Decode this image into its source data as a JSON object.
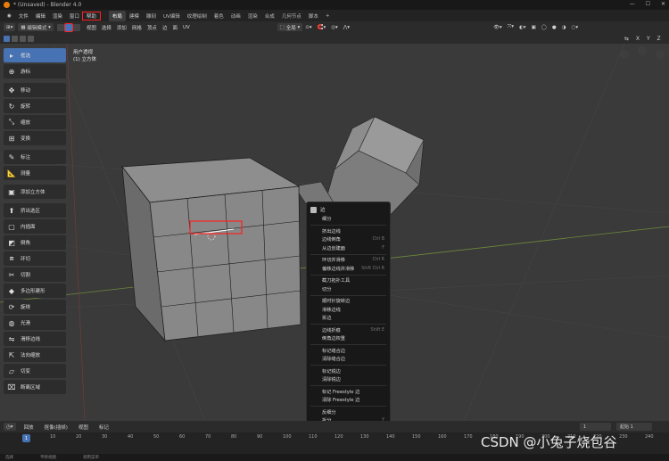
{
  "title": "* (Unsaved) - Blender 4.0",
  "menus": [
    "文件",
    "编辑",
    "渲染",
    "窗口",
    "帮助"
  ],
  "workspaces": [
    "布局",
    "建模",
    "雕刻",
    "UV编辑",
    "纹理绘制",
    "着色",
    "动画",
    "渲染",
    "合成",
    "几何节点",
    "脚本"
  ],
  "active_workspace_index": 0,
  "header": {
    "mode": "编辑模式",
    "menus": [
      "视图",
      "选择",
      "添加",
      "网格",
      "顶点",
      "边",
      "面",
      "UV"
    ],
    "transform": "全局"
  },
  "overlay": {
    "view_name": "用户透视",
    "object": "(1) 立方体"
  },
  "tools": [
    {
      "icon": "select-box-icon",
      "label": "框选",
      "active": true,
      "glyph": "▸"
    },
    {
      "icon": "cursor-icon",
      "label": "游标",
      "glyph": "⊕"
    },
    {
      "icon": "move-icon",
      "label": "移动",
      "glyph": "✥",
      "gap": true
    },
    {
      "icon": "rotate-icon",
      "label": "旋转",
      "glyph": "↻"
    },
    {
      "icon": "scale-icon",
      "label": "缩放",
      "glyph": "⤡"
    },
    {
      "icon": "transform-icon",
      "label": "变换",
      "glyph": "⊞"
    },
    {
      "icon": "annotate-icon",
      "label": "标注",
      "glyph": "✎",
      "gap": true
    },
    {
      "icon": "measure-icon",
      "label": "测量",
      "glyph": "📐"
    },
    {
      "icon": "add-cube-icon",
      "label": "添加立方体",
      "glyph": "▣",
      "gap": true
    },
    {
      "icon": "extrude-icon",
      "label": "挤出选区",
      "glyph": "⬆",
      "gap": true
    },
    {
      "icon": "inset-icon",
      "label": "内插面",
      "glyph": "▢"
    },
    {
      "icon": "bevel-icon",
      "label": "倒角",
      "glyph": "◩"
    },
    {
      "icon": "loop-cut-icon",
      "label": "环切",
      "glyph": "⧈"
    },
    {
      "icon": "knife-icon",
      "label": "切割",
      "glyph": "✂"
    },
    {
      "icon": "poly-build-icon",
      "label": "多边形建形",
      "glyph": "◆"
    },
    {
      "icon": "spin-icon",
      "label": "旋绕",
      "glyph": "⟳"
    },
    {
      "icon": "smooth-icon",
      "label": "光滑",
      "glyph": "◍"
    },
    {
      "icon": "edge-slide-icon",
      "label": "滑移边线",
      "glyph": "⇋"
    },
    {
      "icon": "shrink-fatten-icon",
      "label": "法向缩放",
      "glyph": "⇱"
    },
    {
      "icon": "shear-icon",
      "label": "切变",
      "glyph": "▱"
    },
    {
      "icon": "rip-region-icon",
      "label": "断离区域",
      "glyph": "⌧"
    }
  ],
  "context_menu": {
    "title": "边",
    "groups": [
      [
        {
          "label": "细分",
          "shortcut": ""
        }
      ],
      [
        {
          "label": "挤出边线",
          "shortcut": ""
        },
        {
          "label": "边线倒角",
          "shortcut": "Ctrl B"
        },
        {
          "label": "从边创建面",
          "shortcut": "F"
        }
      ],
      [
        {
          "label": "环切并滑移",
          "shortcut": "Ctrl R"
        },
        {
          "label": "偏移边线并滑移",
          "shortcut": "Shift Ctrl R"
        }
      ],
      [
        {
          "label": "截刀拓扑工具",
          "shortcut": ""
        },
        {
          "label": "切分",
          "shortcut": ""
        }
      ],
      [
        {
          "label": "顺时针旋转边",
          "shortcut": ""
        },
        {
          "label": "滑移边线",
          "shortcut": ""
        },
        {
          "label": "拆边",
          "shortcut": ""
        }
      ],
      [
        {
          "label": "边线折痕",
          "shortcut": "Shift E"
        },
        {
          "label": "倒角边权重",
          "shortcut": ""
        }
      ],
      [
        {
          "label": "标记缝合边",
          "shortcut": ""
        },
        {
          "label": "清除缝合边",
          "shortcut": ""
        }
      ],
      [
        {
          "label": "标记锐边",
          "shortcut": ""
        },
        {
          "label": "清除锐边",
          "shortcut": ""
        }
      ],
      [
        {
          "label": "标记 Freestyle 边",
          "shortcut": ""
        },
        {
          "label": "清除 Freestyle 边",
          "shortcut": ""
        }
      ],
      [
        {
          "label": "反细分",
          "shortcut": ""
        },
        {
          "label": "拆分",
          "shortcut": "Y"
        },
        {
          "label": "分离",
          "shortcut": "P"
        },
        {
          "label": "断开边",
          "shortcut": "",
          "highlight": true
        },
        {
          "label": "断开边",
          "shortcut": ""
        }
      ]
    ]
  },
  "timeline": {
    "menus": [
      "回放",
      "抠像(插帧)",
      "视图",
      "标记"
    ],
    "current_frame": "1",
    "start": "1",
    "end_label": "起始",
    "ticks": [
      "1",
      "10",
      "20",
      "30",
      "40",
      "50",
      "60",
      "70",
      "80",
      "90",
      "100",
      "110",
      "120",
      "130",
      "140",
      "150",
      "160",
      "170",
      "180",
      "190",
      "200",
      "210",
      "220",
      "230",
      "240",
      "250"
    ]
  },
  "status": [
    "选择",
    "平移视图",
    "调用菜单"
  ],
  "watermark": "CSDN @小兔子烧包谷",
  "colors": {
    "accent": "#4772b3",
    "highlight_box": "#ff2020",
    "viewport": "#3a3a3a"
  }
}
